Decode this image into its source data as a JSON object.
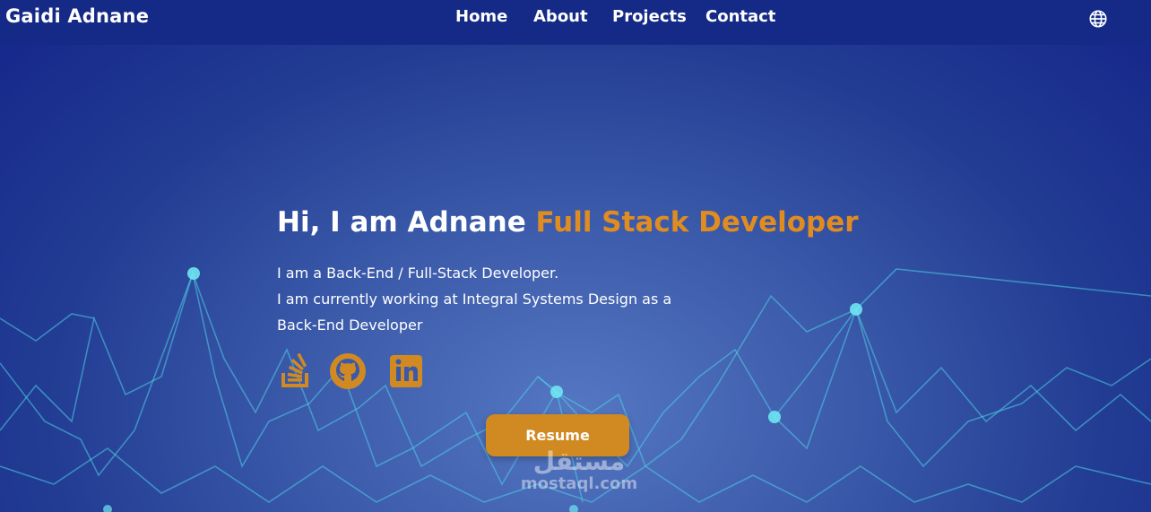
{
  "header": {
    "brand": "Gaidi Adnane",
    "nav": [
      {
        "label": "Home"
      },
      {
        "label": "About"
      },
      {
        "label": "Projects"
      },
      {
        "label": "Contact"
      }
    ],
    "language_icon": "globe-icon"
  },
  "hero": {
    "greeting": "Hi, I am Adnane",
    "role": "Full Stack Developer",
    "lines": [
      "I am a Back-End / Full-Stack Developer.",
      "I am currently working at Integral Systems Design as a",
      "Back-End Developer"
    ],
    "socials": [
      {
        "icon": "stackoverflow-icon"
      },
      {
        "icon": "github-icon"
      },
      {
        "icon": "linkedin-icon"
      }
    ],
    "resume_label": "Resume"
  },
  "watermark": {
    "arabic": "مستقل",
    "latin": "mostaql.com"
  },
  "colors": {
    "accent": "#e08c20",
    "button": "#d18a22",
    "navbar": "#142a86",
    "line": "#4fd0e8"
  }
}
